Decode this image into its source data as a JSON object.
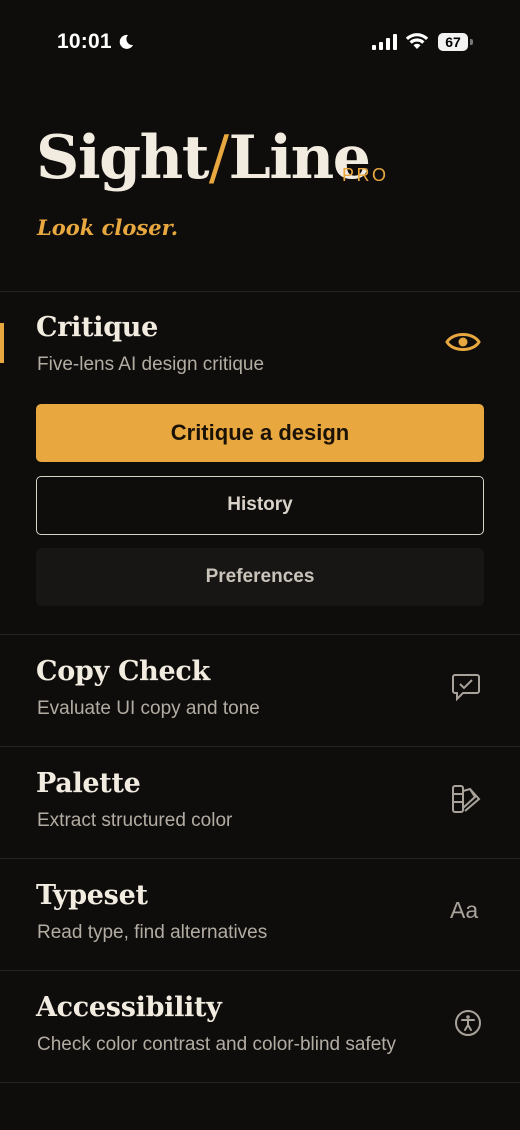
{
  "status_bar": {
    "time": "10:01",
    "battery": "67",
    "icons": [
      "moon-icon",
      "cellular-signal-icon",
      "wifi-icon",
      "battery-icon"
    ]
  },
  "brand": {
    "name_left": "Sight",
    "slash": "/",
    "name_right": "Line",
    "tier": "PRO",
    "tagline": "Look closer."
  },
  "sections": {
    "critique": {
      "title": "Critique",
      "subtitle": "Five-lens AI design critique",
      "icon": "eye-icon",
      "active": true,
      "actions": {
        "primary": "Critique a design",
        "history": "History",
        "preferences": "Preferences"
      }
    },
    "copy_check": {
      "title": "Copy Check",
      "subtitle": "Evaluate UI copy and tone",
      "icon": "chat-check-icon"
    },
    "palette": {
      "title": "Palette",
      "subtitle": "Extract structured color",
      "icon": "swatch-icon"
    },
    "typeset": {
      "title": "Typeset",
      "subtitle": "Read type, find alternatives",
      "icon_text": "Aa"
    },
    "accessibility": {
      "title": "Accessibility",
      "subtitle": "Check color contrast and color-blind safety",
      "icon": "accessibility-icon"
    }
  },
  "colors": {
    "background": "#0e0d0c",
    "accent": "#e8a83f",
    "text": "#f1ebe0",
    "muted": "#b3aca2"
  }
}
